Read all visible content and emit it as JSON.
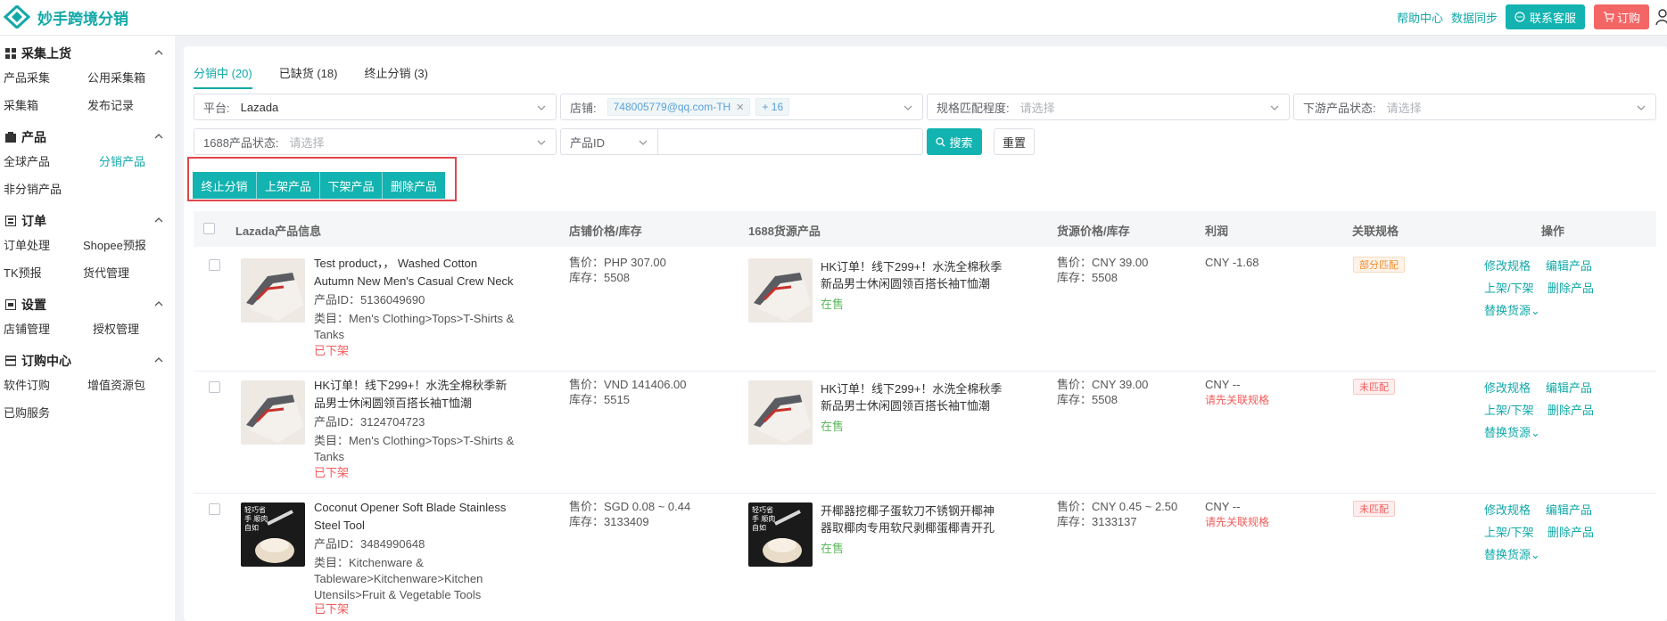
{
  "header": {
    "app_name": "妙手跨境分销",
    "help": "帮助中心",
    "sync": "数据同步",
    "service": "联系客服",
    "buy": "订购"
  },
  "sidebar": {
    "sec1": "采集上货",
    "s1_items": [
      "产品采集",
      "公用采集箱",
      "采集箱",
      "发布记录"
    ],
    "sec2": "产品",
    "s2_items": [
      "全球产品",
      "分销产品",
      "非分销产品"
    ],
    "sec3": "订单",
    "s3_items": [
      "订单处理",
      "Shopee预报",
      "TK预报",
      "货代管理"
    ],
    "sec4": "设置",
    "s4_items": [
      "店铺管理",
      "授权管理"
    ],
    "sec5": "订购中心",
    "s5_items": [
      "软件订购",
      "增值资源包",
      "已购服务"
    ]
  },
  "tabs": [
    "分销中 (20)",
    "已缺货 (18)",
    "终止分销 (3)"
  ],
  "filters": {
    "platform_label": "平台:",
    "platform_value": "Lazada",
    "shop_label": "店铺:",
    "shop_tag": "748005779@qq.com-TH",
    "shop_more": "+ 16",
    "spec_label": "规格匹配程度:",
    "spec_ph": "请选择",
    "downstream_label": "下游产品状态:",
    "downstream_ph": "请选择",
    "status1688_label": "1688产品状态:",
    "status1688_ph": "请选择",
    "id_select": "产品ID",
    "search": "搜索",
    "reset": "重置"
  },
  "actions": [
    "终止分销",
    "上架产品",
    "下架产品",
    "删除产品"
  ],
  "columns": [
    "Lazada产品信息",
    "店铺价格/库存",
    "1688货源产品",
    "货源价格/库存",
    "利润",
    "关联规格",
    "操作"
  ],
  "rows": [
    {
      "title": "Test product，， Washed Cotton Autumn New Men's Casual Crew Neck Versatile ...",
      "pid": "产品ID：5136049690",
      "category": "类目：Men's Clothing>Tops>T-Shirts & Tanks",
      "status": "已下架",
      "shop_price": "售价：PHP 307.00",
      "shop_stock": "库存：5508",
      "source_title": "HK订单！线下299+！水洗全棉秋季新品男士休闲圆领百搭长袖T恤潮",
      "source_status": "在售",
      "src_price": "售价：CNY 39.00",
      "src_stock": "库存：5508",
      "profit": "CNY -1.68",
      "profit_note": "",
      "match": "部分匹配",
      "match_type": "partial"
    },
    {
      "title": "HK订单！线下299+！水洗全棉秋季新品男士休闲圆领百搭长袖T恤潮",
      "pid": "产品ID：3124704723",
      "category": "类目：Men's Clothing>Tops>T-Shirts & Tanks",
      "status": "已下架",
      "shop_price": "售价：VND 141406.00",
      "shop_stock": "库存：5515",
      "source_title": "HK订单！线下299+！水洗全棉秋季新品男士休闲圆领百搭长袖T恤潮",
      "source_status": "在售",
      "src_price": "售价：CNY 39.00",
      "src_stock": "库存：5508",
      "profit": "CNY --",
      "profit_note": "请先关联规格",
      "match": "未匹配",
      "match_type": "none"
    },
    {
      "title": "Coconut Opener Soft Blade Stainless Steel Tool",
      "pid": "产品ID：3484990648",
      "category": "类目：Kitchenware & Tableware>Kitchenware>Kitchen Utensils>Fruit & Vegetable Tools",
      "status": "已下架",
      "shop_price": "售价：SGD 0.08 ~ 0.44",
      "shop_stock": "库存：3133409",
      "source_title": "开椰器挖椰子蛋软刀不锈钢开椰神器取椰肉专用软尺剥椰蛋椰青开孔",
      "source_status": "在售",
      "src_price": "售价：CNY 0.45 ~ 2.50",
      "src_stock": "库存：3133137",
      "profit": "CNY --",
      "profit_note": "请先关联规格",
      "match": "未匹配",
      "match_type": "none"
    }
  ],
  "ops": {
    "edit_spec": "修改规格",
    "edit_product": "编辑产品",
    "shelf": "上架/下架",
    "delete": "删除产品",
    "replace": "替换货源"
  },
  "thumb_overlay": "轻巧省手 顺肉自如"
}
